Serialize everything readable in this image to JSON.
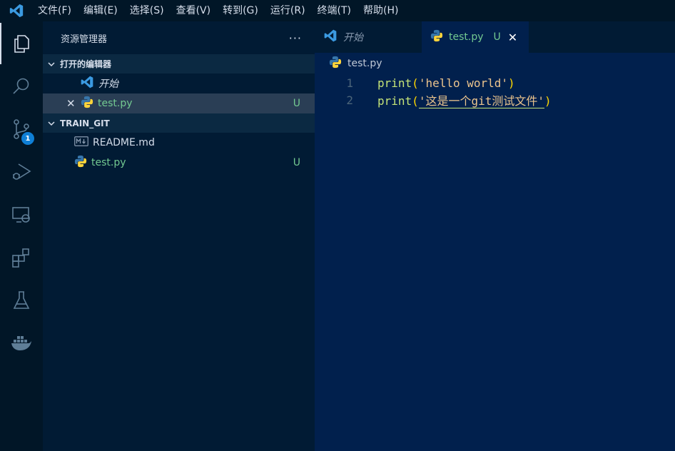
{
  "menu": {
    "items": [
      "文件(F)",
      "编辑(E)",
      "选择(S)",
      "查看(V)",
      "转到(G)",
      "运行(R)",
      "终端(T)",
      "帮助(H)"
    ]
  },
  "activity": {
    "source_control_badge": "1"
  },
  "explorer": {
    "title": "资源管理器",
    "more": "···",
    "open_editors": {
      "title": "打开的编辑器",
      "items": [
        {
          "name": "开始"
        },
        {
          "name": "test.py",
          "status": "U"
        }
      ]
    },
    "folder": {
      "title": "TRAIN_GIT",
      "items": [
        {
          "name": "README.md"
        },
        {
          "name": "test.py",
          "status": "U"
        }
      ]
    }
  },
  "editor": {
    "tabs": [
      {
        "label": "开始"
      },
      {
        "label": "test.py",
        "status": "U",
        "close": "✕"
      }
    ],
    "breadcrumb": "test.py",
    "lines": [
      {
        "num": "1",
        "fn": "print",
        "open": "(",
        "str": "'hello world'",
        "close": ")"
      },
      {
        "num": "2",
        "fn": "print",
        "open": "(",
        "str": "'这是一个git测试文件'",
        "close": ")"
      }
    ]
  },
  "colors": {
    "background": "#011627",
    "editor_bg": "#01204d",
    "accent_green": "#73c991",
    "badge": "#0f7fd6"
  }
}
